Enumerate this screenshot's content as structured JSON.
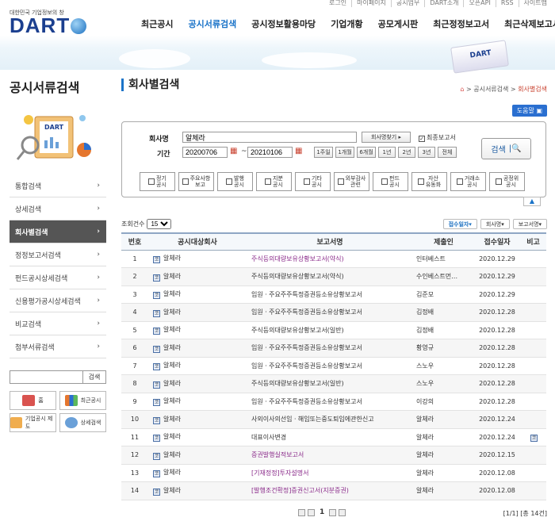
{
  "header": {
    "util_links": [
      "로그인",
      "마이페이지",
      "공시업무",
      "DART소개",
      "오픈API",
      "RSS",
      "사이트맵"
    ],
    "logo_sub": "대한민국 기업정보의 창",
    "logo": "DART",
    "nav": [
      "최근공시",
      "공시서류검색",
      "공시정보활용마당",
      "기업개황",
      "공모게시판",
      "최근정정보고서",
      "최근삭제보고서"
    ],
    "nav_active": "공시서류검색",
    "banner_book": "DART"
  },
  "sidebar": {
    "title": "공시서류검색",
    "image_label": "DART",
    "items": [
      {
        "label": "통합검색"
      },
      {
        "label": "상세검색"
      },
      {
        "label": "회사별검색"
      },
      {
        "label": "정정보고서검색"
      },
      {
        "label": "펀드공시상세검색"
      },
      {
        "label": "신용평가공시상세검색"
      },
      {
        "label": "비교검색"
      },
      {
        "label": "첨부서류검색"
      }
    ],
    "active": "회사별검색",
    "search_button": "검색",
    "quick_links": [
      "홈",
      "최근공시",
      "기업공시 제도",
      "상세검색"
    ]
  },
  "page": {
    "title": "회사별검색",
    "breadcrumb": [
      "공시서류검색",
      "회사별검색"
    ],
    "help": "도움말"
  },
  "form": {
    "company_label": "회사명",
    "company_value": "알체라",
    "company_find": "회사명찾기",
    "final_report": "최종보고서",
    "period_label": "기간",
    "start_date": "20200706",
    "end_date": "20210106",
    "periods": [
      "1주일",
      "1개월",
      "6개월",
      "1년",
      "2년",
      "3년",
      "전체"
    ],
    "search": "검색",
    "types": [
      "정기\n공시",
      "주요사항\n보고",
      "발행\n공시",
      "지분\n공시",
      "기타\n공시",
      "외부감사\n관련",
      "펀드\n공시",
      "자산\n유동화",
      "거래소\n공시",
      "공정위\n공시"
    ]
  },
  "results": {
    "count_label": "조회건수",
    "count_value": "15",
    "sorts": [
      "접수일자",
      "회사명",
      "보고서명"
    ],
    "headers": [
      "번호",
      "공시대상회사",
      "보고서명",
      "제출인",
      "접수일자",
      "비고"
    ],
    "rows": [
      {
        "no": "1",
        "corp": "알체라",
        "report": "주식등의대량보유상황보고서(약식)",
        "submitter": "인터베스트",
        "date": "2020.12.29",
        "note": "",
        "purple": true
      },
      {
        "no": "2",
        "corp": "알체라",
        "report": "주식등의대량보유상황보고서(약식)",
        "submitter": "수인베스트먼…",
        "date": "2020.12.29",
        "note": "",
        "purple": false
      },
      {
        "no": "3",
        "corp": "알체라",
        "report": "임원ㆍ주요주주특정증권등소유상황보고서",
        "submitter": "김준모",
        "date": "2020.12.29",
        "note": "",
        "purple": false
      },
      {
        "no": "4",
        "corp": "알체라",
        "report": "임원ㆍ주요주주특정증권등소유상황보고서",
        "submitter": "김정배",
        "date": "2020.12.28",
        "note": "",
        "purple": false
      },
      {
        "no": "5",
        "corp": "알체라",
        "report": "주식등의대량보유상황보고서(일반)",
        "submitter": "김정배",
        "date": "2020.12.28",
        "note": "",
        "purple": false
      },
      {
        "no": "6",
        "corp": "알체라",
        "report": "임원ㆍ주요주주특정증권등소유상황보고서",
        "submitter": "황영규",
        "date": "2020.12.28",
        "note": "",
        "purple": false
      },
      {
        "no": "7",
        "corp": "알체라",
        "report": "임원ㆍ주요주주특정증권등소유상황보고서",
        "submitter": "스노우",
        "date": "2020.12.28",
        "note": "",
        "purple": false
      },
      {
        "no": "8",
        "corp": "알체라",
        "report": "주식등의대량보유상황보고서(일반)",
        "submitter": "스노우",
        "date": "2020.12.28",
        "note": "",
        "purple": false
      },
      {
        "no": "9",
        "corp": "알체라",
        "report": "임원ㆍ주요주주특정증권등소유상황보고서",
        "submitter": "이강의",
        "date": "2020.12.28",
        "note": "",
        "purple": false
      },
      {
        "no": "10",
        "corp": "알체라",
        "report": "사외이사의선임ㆍ해임또는중도퇴임에관한신고",
        "submitter": "알체라",
        "date": "2020.12.24",
        "note": "",
        "purple": false
      },
      {
        "no": "11",
        "corp": "알체라",
        "report": "대표이사변경",
        "submitter": "알체라",
        "date": "2020.12.24",
        "note": "코",
        "purple": false
      },
      {
        "no": "12",
        "corp": "알체라",
        "report": "증권발행실적보고서",
        "submitter": "알체라",
        "date": "2020.12.15",
        "note": "",
        "purple": true
      },
      {
        "no": "13",
        "corp": "알체라",
        "report": "[기재정정]투자설명서",
        "submitter": "알체라",
        "date": "2020.12.08",
        "note": "",
        "purple": true
      },
      {
        "no": "14",
        "corp": "알체라",
        "report": "[발행조건확정]증권신고서(지분증권)",
        "submitter": "알체라",
        "date": "2020.12.08",
        "note": "",
        "purple": true
      }
    ],
    "page_current": "1",
    "page_info": "[1/1] [총 14건]"
  },
  "colors": {
    "brand": "#1b3f8f",
    "accent": "#1a73c8",
    "purple": "#8a2a8a"
  }
}
